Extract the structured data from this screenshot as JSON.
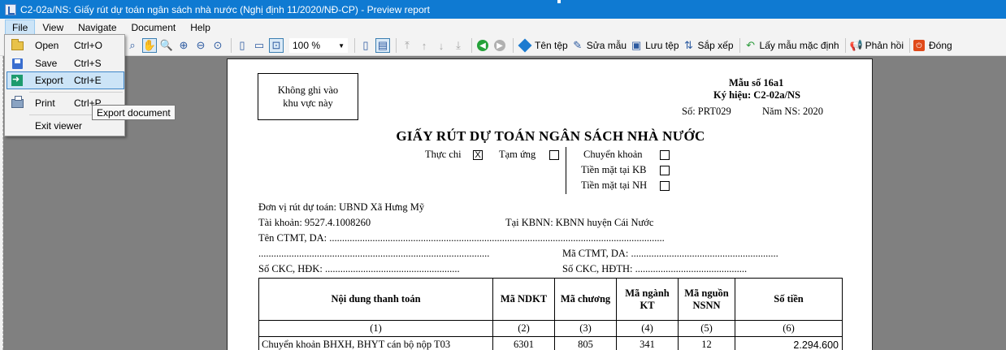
{
  "window": {
    "title": "C2-02a/NS: Giấy rút dự toán ngân sách nhà nước (Nghị định 11/2020/NĐ-CP) - Preview report"
  },
  "menubar": [
    "File",
    "View",
    "Navigate",
    "Document",
    "Help"
  ],
  "file_menu": {
    "items": [
      {
        "label": "Open",
        "shortcut": "Ctrl+O",
        "icon": "open-folder-icon"
      },
      {
        "label": "Save",
        "shortcut": "Ctrl+S",
        "icon": "save-icon"
      },
      {
        "label": "Export",
        "shortcut": "Ctrl+E",
        "icon": "export-icon",
        "highlighted": true
      },
      {
        "label": "Print",
        "shortcut": "Ctrl+P",
        "icon": "print-icon"
      },
      {
        "label": "Exit viewer",
        "shortcut": ""
      }
    ],
    "tooltip": "Export document"
  },
  "toolbar": {
    "zoom": "100 %",
    "ten_tep": "Tên tệp",
    "sua_mau": "Sửa mẫu",
    "luu_tep": "Lưu tệp",
    "sap_xep": "Sắp xếp",
    "lay_mau": "Lấy mẫu mặc định",
    "phan_hoi": "Phản hồi",
    "dong": "Đóng"
  },
  "report": {
    "note_box": [
      "Không ghi vào",
      "khu vực này"
    ],
    "mau_so": "Mẫu số 16a1",
    "ky_hieu": "Ký hiệu: C2-02a/NS",
    "so": "Số: PRT029",
    "nam_ns": "Năm NS:  2020",
    "title": "GIẤY RÚT DỰ TOÁN NGÂN SÁCH NHÀ NƯỚC",
    "thuc_chi": "Thực chi",
    "thuc_chi_mark": "X",
    "tam_ung": "Tạm ứng",
    "chuyen_khoan": "Chuyển khoản",
    "tien_mat_kb": "Tiền mặt tại KB",
    "tien_mat_nh": "Tiền mặt tại NH",
    "don_vi": "Đơn vị rút dự toán:  UBND Xã Hưng Mỹ",
    "tai_khoan": "Tài khoản:  9527.4.1008260",
    "tai_kbnn": "Tại KBNN:  KBNN huyện Cái Nước",
    "ten_ctmt": "Tên CTMT, DA:  ....................................................................................................................................",
    "dots_line": "...........................................................................................",
    "ma_ctmt": "Mã CTMT, DA:  ..........................................................",
    "so_ckc_hdk": "Số CKC, HĐK: .....................................................",
    "so_ckc_hdth": "Số CKC, HĐTH: ............................................",
    "table": {
      "headers": [
        "Nội dung thanh toán",
        "Mã NDKT",
        "Mã chương",
        "Mã ngành KT",
        "Mã nguồn NSNN",
        "Số tiền"
      ],
      "numbers": [
        "(1)",
        "(2)",
        "(3)",
        "(4)",
        "(5)",
        "(6)"
      ],
      "rows": [
        [
          "Chuyển khoản BHXH, BHYT cán bộ nộp T03",
          "6301",
          "805",
          "341",
          "12",
          "2.294.600"
        ]
      ]
    }
  }
}
